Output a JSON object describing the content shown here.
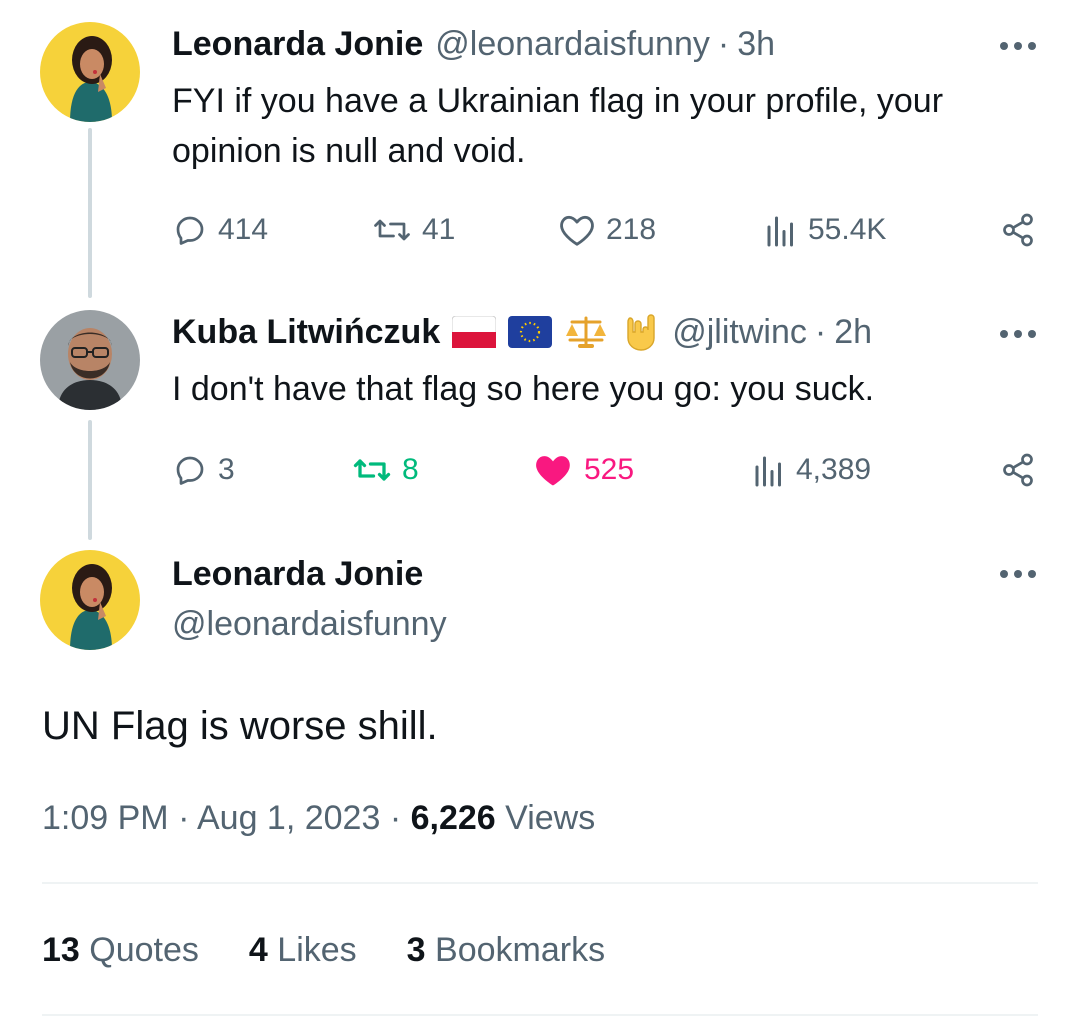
{
  "tweets": [
    {
      "name": "Leonarda Jonie",
      "handle": "@leonardaisfunny",
      "time": "3h",
      "text": "FYI if you have a Ukrainian flag in your profile, your opinion is null and void.",
      "replies": "414",
      "retweets": "41",
      "likes": "218",
      "views": "55.4K"
    },
    {
      "name": "Kuba Litwińczuk",
      "handle": "@jlitwinc",
      "time": "2h",
      "text": "I don't have that flag so here you go: you suck.",
      "replies": "3",
      "retweets": "8",
      "likes": "525",
      "views": "4,389",
      "name_emojis": [
        "flag-poland-icon",
        "flag-eu-icon",
        "scales-icon",
        "rock-hand-icon"
      ]
    }
  ],
  "main_tweet": {
    "name": "Leonarda Jonie",
    "handle": "@leonardaisfunny",
    "text": "UN Flag is worse shill.",
    "time": "1:09 PM",
    "date": "Aug 1, 2023",
    "views_count": "6,226",
    "views_label": "Views"
  },
  "stats": {
    "quotes_count": "13",
    "quotes_label": "Quotes",
    "likes_count": "4",
    "likes_label": "Likes",
    "bookmarks_count": "3",
    "bookmarks_label": "Bookmarks"
  },
  "separator": "·",
  "colors": {
    "text": "#0f1419",
    "secondary": "#536471",
    "retweet_active": "#00ba7c",
    "like_active": "#f91880",
    "avatar_bg": "#f6d23a"
  }
}
